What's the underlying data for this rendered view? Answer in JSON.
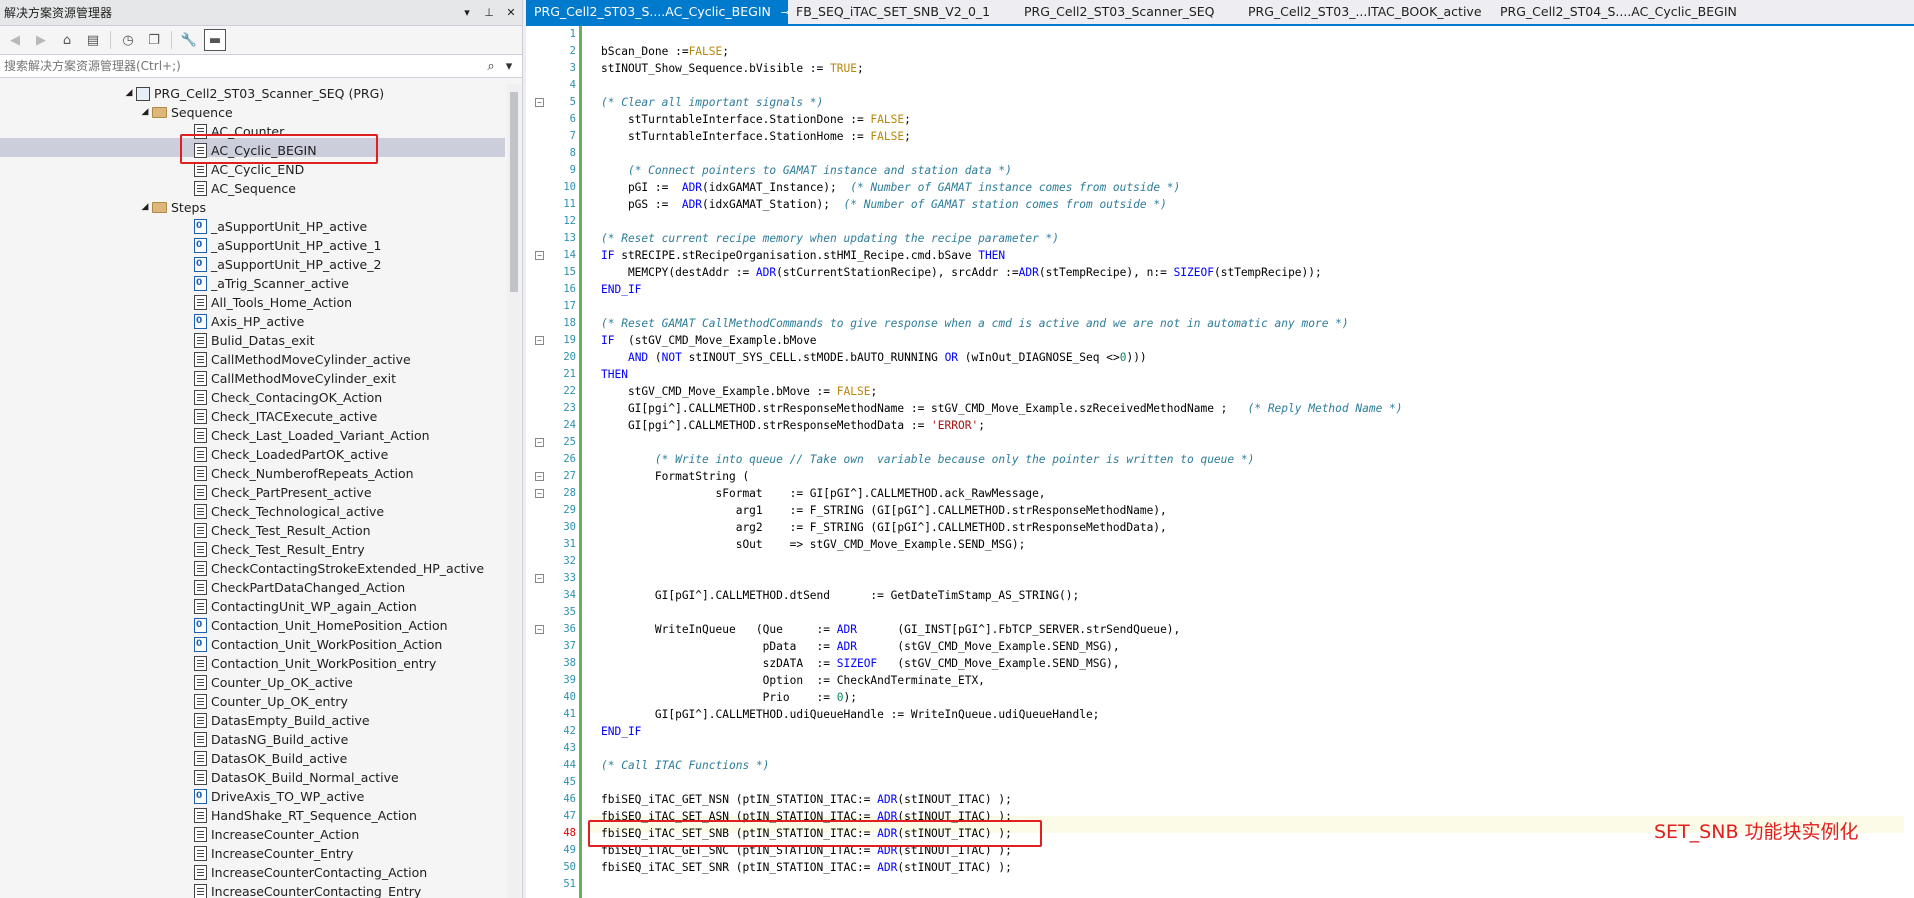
{
  "explorer": {
    "title": "解决方案资源管理器",
    "title_controls": [
      "▾",
      "⊥",
      "✕"
    ],
    "search_placeholder": "搜索解决方案资源管理器(Ctrl+;)",
    "tree": [
      {
        "label": "PRG_Cell2_ST03_Scanner_SEQ (PRG)",
        "icon": "prg-icon",
        "level": 0,
        "expanded": true
      },
      {
        "label": "Sequence",
        "icon": "folder-icon",
        "level": 1,
        "expanded": true
      },
      {
        "label": "AC_Counter",
        "icon": "action-icon",
        "level": 2
      },
      {
        "label": "AC_Cyclic_BEGIN",
        "icon": "action-icon",
        "level": 2,
        "selected": true
      },
      {
        "label": "AC_Cyclic_END",
        "icon": "action-icon",
        "level": 2
      },
      {
        "label": "AC_Sequence",
        "icon": "action-icon",
        "level": 2
      },
      {
        "label": "Steps",
        "icon": "folder-icon",
        "level": 1,
        "expanded": true
      },
      {
        "label": "_aSupportUnit_HP_active",
        "icon": "transition-icon",
        "level": 2
      },
      {
        "label": "_aSupportUnit_HP_active_1",
        "icon": "transition-icon",
        "level": 2
      },
      {
        "label": "_aSupportUnit_HP_active_2",
        "icon": "transition-icon",
        "level": 2
      },
      {
        "label": "_aTrig_Scanner_active",
        "icon": "transition-icon",
        "level": 2
      },
      {
        "label": "All_Tools_Home_Action",
        "icon": "action-icon",
        "level": 2
      },
      {
        "label": "Axis_HP_active",
        "icon": "transition-icon",
        "level": 2
      },
      {
        "label": "Bulid_Datas_exit",
        "icon": "action-icon",
        "level": 2
      },
      {
        "label": "CallMethodMoveCylinder_active",
        "icon": "action-icon",
        "level": 2
      },
      {
        "label": "CallMethodMoveCylinder_exit",
        "icon": "action-icon",
        "level": 2
      },
      {
        "label": "Check_ContacingOK_Action",
        "icon": "action-icon",
        "level": 2
      },
      {
        "label": "Check_ITACExecute_active",
        "icon": "action-icon",
        "level": 2
      },
      {
        "label": "Check_Last_Loaded_Variant_Action",
        "icon": "action-icon",
        "level": 2
      },
      {
        "label": "Check_LoadedPartOK_active",
        "icon": "action-icon",
        "level": 2
      },
      {
        "label": "Check_NumberofRepeats_Action",
        "icon": "action-icon",
        "level": 2
      },
      {
        "label": "Check_PartPresent_active",
        "icon": "action-icon",
        "level": 2
      },
      {
        "label": "Check_Technological_active",
        "icon": "action-icon",
        "level": 2
      },
      {
        "label": "Check_Test_Result_Action",
        "icon": "action-icon",
        "level": 2
      },
      {
        "label": "Check_Test_Result_Entry",
        "icon": "action-icon",
        "level": 2
      },
      {
        "label": "CheckContactingStrokeExtended_HP_active",
        "icon": "action-icon",
        "level": 2
      },
      {
        "label": "CheckPartDataChanged_Action",
        "icon": "action-icon",
        "level": 2
      },
      {
        "label": "ContactingUnit_WP_again_Action",
        "icon": "action-icon",
        "level": 2
      },
      {
        "label": "Contaction_Unit_HomePosition_Action",
        "icon": "transition-icon",
        "level": 2
      },
      {
        "label": "Contaction_Unit_WorkPosition_Action",
        "icon": "transition-icon",
        "level": 2
      },
      {
        "label": "Contaction_Unit_WorkPosition_entry",
        "icon": "action-icon",
        "level": 2
      },
      {
        "label": "Counter_Up_OK_active",
        "icon": "action-icon",
        "level": 2
      },
      {
        "label": "Counter_Up_OK_entry",
        "icon": "action-icon",
        "level": 2
      },
      {
        "label": "DatasEmpty_Build_active",
        "icon": "action-icon",
        "level": 2
      },
      {
        "label": "DatasNG_Build_active",
        "icon": "action-icon",
        "level": 2
      },
      {
        "label": "DatasOK_Build_active",
        "icon": "action-icon",
        "level": 2
      },
      {
        "label": "DatasOK_Build_Normal_active",
        "icon": "action-icon",
        "level": 2
      },
      {
        "label": "DriveAxis_TO_WP_active",
        "icon": "transition-icon",
        "level": 2
      },
      {
        "label": "HandShake_RT_Sequence_Action",
        "icon": "action-icon",
        "level": 2
      },
      {
        "label": "IncreaseCounter_Action",
        "icon": "action-icon",
        "level": 2
      },
      {
        "label": "IncreaseCounter_Entry",
        "icon": "action-icon",
        "level": 2
      },
      {
        "label": "IncreaseCounterContacting_Action",
        "icon": "action-icon",
        "level": 2
      },
      {
        "label": "IncreaseCounterContacting_Entry",
        "icon": "action-icon",
        "level": 2
      }
    ]
  },
  "editor": {
    "tabs": [
      {
        "label": "PRG_Cell2_ST03_S....AC_Cyclic_BEGIN",
        "active": true,
        "pin": "⊸",
        "close": "✕"
      },
      {
        "label": "FB_SEQ_iTAC_SET_SNB_V2_0_1",
        "active": false
      },
      {
        "label": "PRG_Cell2_ST03_Scanner_SEQ",
        "active": false
      },
      {
        "label": "PRG_Cell2_ST03_...ITAC_BOOK_active",
        "active": false
      },
      {
        "label": "PRG_Cell2_ST04_S....AC_Cyclic_BEGIN",
        "active": false
      }
    ],
    "current_line": 48,
    "fold_lines": [
      5,
      14,
      19,
      25,
      27,
      28,
      33,
      36
    ],
    "lines": [
      {
        "n": 1,
        "t": ""
      },
      {
        "n": 2,
        "t": "bScan_Done :=FALSE;"
      },
      {
        "n": 3,
        "t": "stINOUT_Show_Sequence.bVisible := TRUE;"
      },
      {
        "n": 4,
        "t": ""
      },
      {
        "n": 5,
        "t": "(* Clear all important signals *)"
      },
      {
        "n": 6,
        "t": "    stTurntableInterface.StationDone := FALSE;"
      },
      {
        "n": 7,
        "t": "    stTurntableInterface.StationHome := FALSE;"
      },
      {
        "n": 8,
        "t": ""
      },
      {
        "n": 9,
        "t": "    (* Connect pointers to GAMAT instance and station data *)"
      },
      {
        "n": 10,
        "t": "    pGI :=  ADR(idxGAMAT_Instance);  (* Number of GAMAT instance comes from outside *)"
      },
      {
        "n": 11,
        "t": "    pGS :=  ADR(idxGAMAT_Station);  (* Number of GAMAT station comes from outside *)"
      },
      {
        "n": 12,
        "t": ""
      },
      {
        "n": 13,
        "t": "(* Reset current recipe memory when updating the recipe parameter *)"
      },
      {
        "n": 14,
        "t": "IF stRECIPE.stRecipeOrganisation.stHMI_Recipe.cmd.bSave THEN"
      },
      {
        "n": 15,
        "t": "    MEMCPY(destAddr := ADR(stCurrentStationRecipe), srcAddr :=ADR(stTempRecipe), n:= SIZEOF(stTempRecipe));"
      },
      {
        "n": 16,
        "t": "END_IF"
      },
      {
        "n": 17,
        "t": ""
      },
      {
        "n": 18,
        "t": "(* Reset GAMAT CallMethodCommands to give response when a cmd is active and we are not in automatic any more *)"
      },
      {
        "n": 19,
        "t": "IF  (stGV_CMD_Move_Example.bMove"
      },
      {
        "n": 20,
        "t": "    AND (NOT stINOUT_SYS_CELL.stMODE.bAUTO_RUNNING OR (wInOut_DIAGNOSE_Seq <>0)))"
      },
      {
        "n": 21,
        "t": "THEN"
      },
      {
        "n": 22,
        "t": "    stGV_CMD_Move_Example.bMove := FALSE;"
      },
      {
        "n": 23,
        "t": "    GI[pgi^].CALLMETHOD.strResponseMethodName := stGV_CMD_Move_Example.szReceivedMethodName ;   (* Reply Method Name *)"
      },
      {
        "n": 24,
        "t": "    GI[pgi^].CALLMETHOD.strResponseMethodData := 'ERROR';"
      },
      {
        "n": 25,
        "t": ""
      },
      {
        "n": 26,
        "t": "        (* Write into queue // Take own  variable because only the pointer is written to queue *)"
      },
      {
        "n": 27,
        "t": "        FormatString ("
      },
      {
        "n": 28,
        "t": "                 sFormat    := GI[pGI^].CALLMETHOD.ack_RawMessage,"
      },
      {
        "n": 29,
        "t": "                    arg1    := F_STRING (GI[pGI^].CALLMETHOD.strResponseMethodName),"
      },
      {
        "n": 30,
        "t": "                    arg2    := F_STRING (GI[pGI^].CALLMETHOD.strResponseMethodData),"
      },
      {
        "n": 31,
        "t": "                    sOut    => stGV_CMD_Move_Example.SEND_MSG);"
      },
      {
        "n": 32,
        "t": ""
      },
      {
        "n": 33,
        "t": ""
      },
      {
        "n": 34,
        "t": "        GI[pGI^].CALLMETHOD.dtSend      := GetDateTimStamp_AS_STRING();"
      },
      {
        "n": 35,
        "t": ""
      },
      {
        "n": 36,
        "t": "        WriteInQueue   (Que     := ADR      (GI_INST[pGI^].FbTCP_SERVER.strSendQueue),"
      },
      {
        "n": 37,
        "t": "                        pData   := ADR      (stGV_CMD_Move_Example.SEND_MSG),"
      },
      {
        "n": 38,
        "t": "                        szDATA  := SIZEOF   (stGV_CMD_Move_Example.SEND_MSG),"
      },
      {
        "n": 39,
        "t": "                        Option  := CheckAndTerminate_ETX,"
      },
      {
        "n": 40,
        "t": "                        Prio    := 0);"
      },
      {
        "n": 41,
        "t": "        GI[pGI^].CALLMETHOD.udiQueueHandle := WriteInQueue.udiQueueHandle;"
      },
      {
        "n": 42,
        "t": "END_IF"
      },
      {
        "n": 43,
        "t": ""
      },
      {
        "n": 44,
        "t": "(* Call ITAC Functions *)"
      },
      {
        "n": 45,
        "t": ""
      },
      {
        "n": 46,
        "t": "fbiSEQ_iTAC_GET_NSN (ptIN_STATION_ITAC:= ADR(stINOUT_ITAC) );"
      },
      {
        "n": 47,
        "t": "fbiSEQ_iTAC_SET_ASN (ptIN_STATION_ITAC:= ADR(stINOUT_ITAC) );"
      },
      {
        "n": 48,
        "t": "fbiSEQ_iTAC_SET_SNB (ptIN_STATION_ITAC:= ADR(stINOUT_ITAC) );"
      },
      {
        "n": 49,
        "t": "fbiSEQ_iTAC_GET_SNC (ptIN_STATION_ITAC:= ADR(stINOUT_ITAC) );"
      },
      {
        "n": 50,
        "t": "fbiSEQ_iTAC_SET_SNR (ptIN_STATION_ITAC:= ADR(stINOUT_ITAC) );"
      },
      {
        "n": 51,
        "t": ""
      }
    ]
  },
  "annotation": {
    "text": "SET_SNB 功能块实例化",
    "color": "#e02020"
  },
  "colors": {
    "accent": "#007acc",
    "selection": "#cccedb",
    "highlight_box": "#e02020"
  }
}
